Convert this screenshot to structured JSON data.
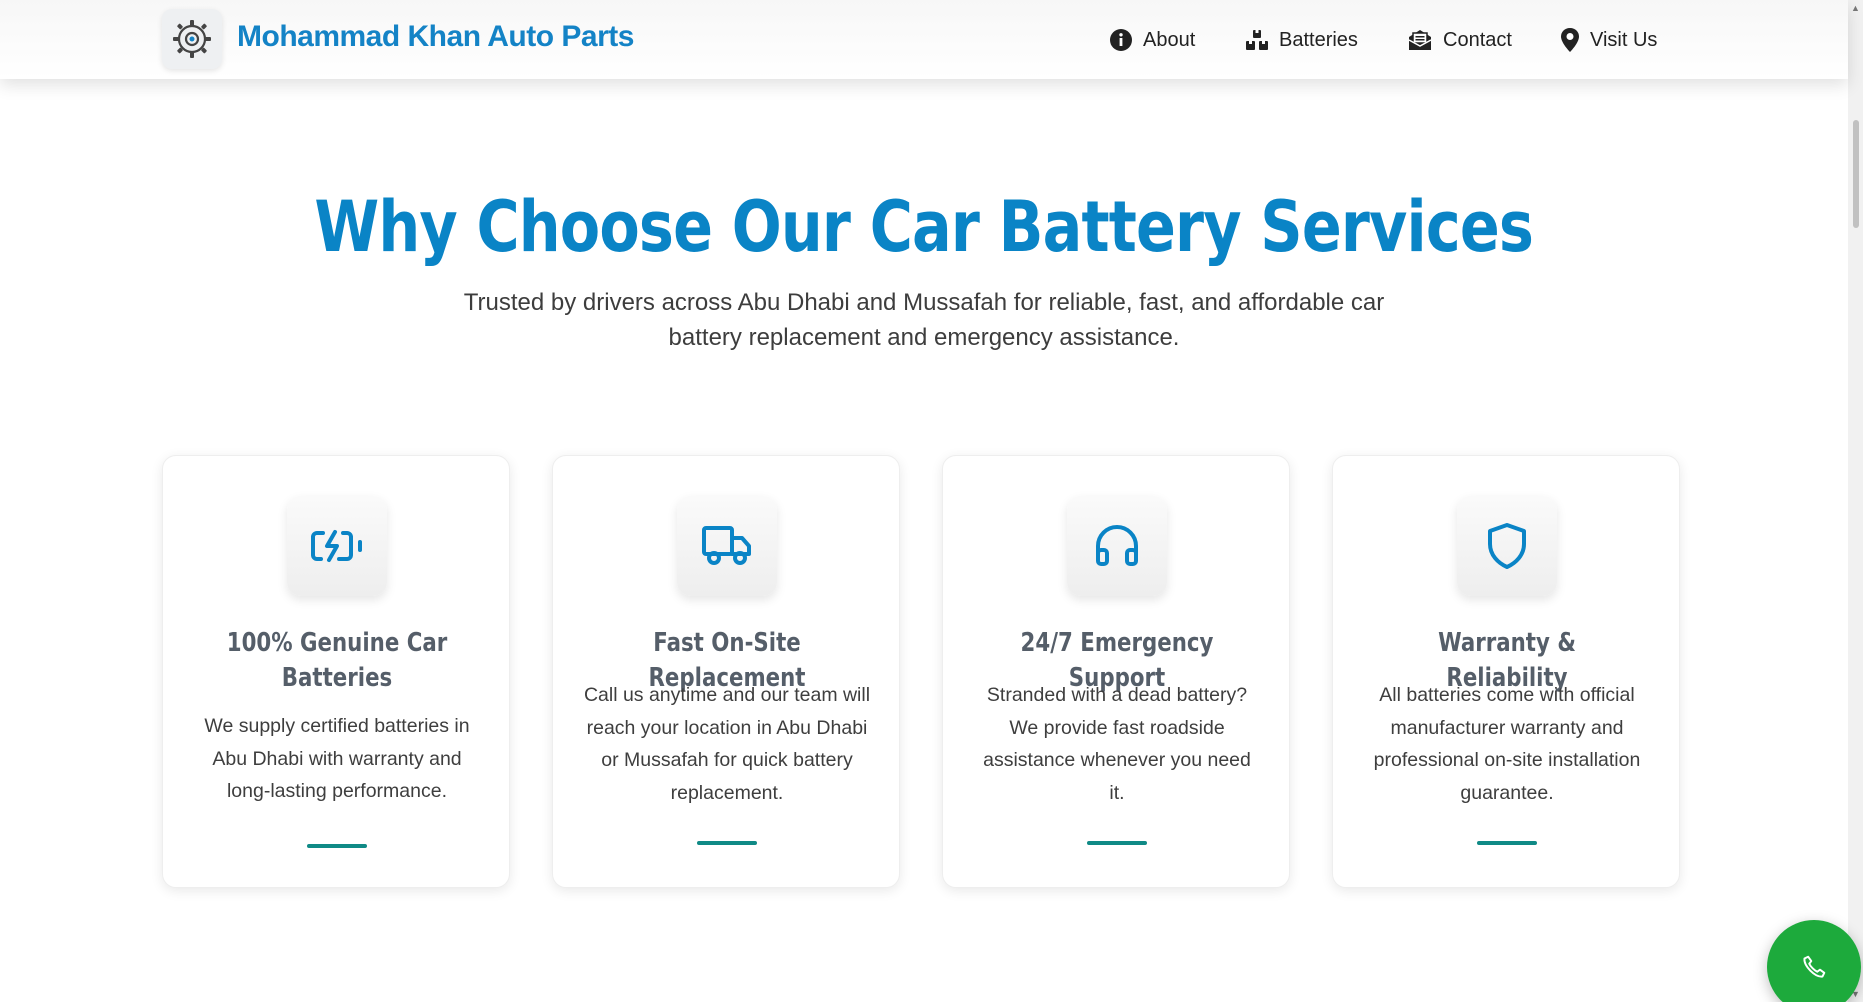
{
  "header": {
    "brand": "Mohammad Khan Auto Parts",
    "logo_icon": "gear-logo-icon",
    "nav": [
      {
        "label": "About",
        "icon": "info-circle-icon"
      },
      {
        "label": "Batteries",
        "icon": "boxes-icon"
      },
      {
        "label": "Contact",
        "icon": "envelope-open-icon"
      },
      {
        "label": "Visit Us",
        "icon": "map-pin-icon"
      }
    ]
  },
  "hero": {
    "title": "Why Choose Our Car Battery Services",
    "subtitle": "Trusted by drivers across Abu Dhabi and Mussafah for reliable, fast, and affordable car battery replacement and emergency assistance."
  },
  "features": [
    {
      "icon": "battery-charging-icon",
      "title": "100% Genuine Car Batteries",
      "text": "We supply certified batteries in Abu Dhabi with warranty and long-lasting performance."
    },
    {
      "icon": "truck-icon",
      "title": "Fast On-Site Replacement",
      "text": "Call us anytime and our team will reach your location in Abu Dhabi or Mussafah for quick battery replacement."
    },
    {
      "icon": "headphones-icon",
      "title": "24/7 Emergency Support",
      "text": "Stranded with a dead battery? We provide fast roadside assistance whenever you need it."
    },
    {
      "icon": "shield-icon",
      "title": "Warranty & Reliability",
      "text": "All batteries come with official manufacturer warranty and professional on-site installation guarantee."
    }
  ],
  "floating": {
    "icon": "phone-icon"
  },
  "colors": {
    "brand_blue": "#1483c6",
    "title_blue": "#0a84c6",
    "accent_teal": "#0f8a86",
    "call_green": "#1daa3c"
  }
}
